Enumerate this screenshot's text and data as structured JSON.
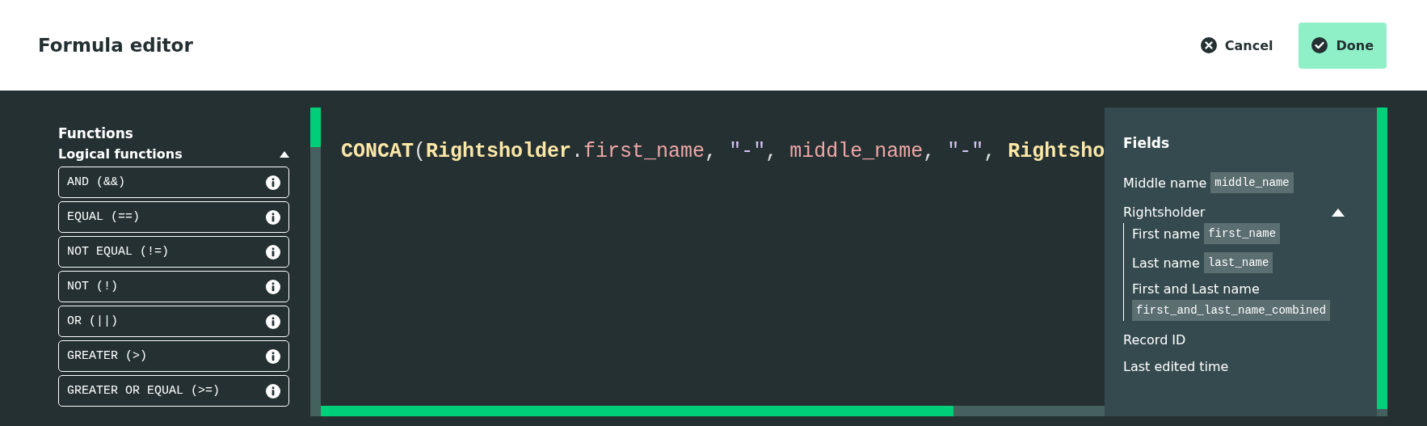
{
  "header": {
    "title": "Formula editor",
    "buttons": [
      {
        "kind": "cancel",
        "label": "Cancel"
      },
      {
        "kind": "done",
        "label": "Done"
      }
    ]
  },
  "functions": {
    "title": "Functions",
    "groups": [
      {
        "label": "Logical functions",
        "expanded": true,
        "items": [
          "AND (&&)",
          "EQUAL (==)",
          "NOT EQUAL (!=)",
          "NOT (!)",
          "OR (||)",
          "GREATER (>)",
          "GREATER OR EQUAL (>=)"
        ]
      }
    ]
  },
  "editor": {
    "tokens": [
      {
        "kind": "function",
        "text": "CONCAT"
      },
      {
        "kind": "punct",
        "text": "("
      },
      {
        "kind": "object",
        "text": "Rightsholder"
      },
      {
        "kind": "punct",
        "text": "."
      },
      {
        "kind": "field",
        "text": "first_name"
      },
      {
        "kind": "punct",
        "text": ", "
      },
      {
        "kind": "string",
        "text": "\"-\""
      },
      {
        "kind": "punct",
        "text": ", "
      },
      {
        "kind": "field",
        "text": "middle_name"
      },
      {
        "kind": "punct",
        "text": ", "
      },
      {
        "kind": "string",
        "text": "\"-\""
      },
      {
        "kind": "punct",
        "text": ", "
      },
      {
        "kind": "object",
        "text": "Rightsho"
      }
    ]
  },
  "fields": {
    "title": "Fields",
    "items": [
      {
        "label": "Middle name",
        "code": "middle_name"
      },
      {
        "label": "Rightsholder",
        "expanded": true,
        "children": [
          {
            "label": "First name",
            "code": "first_name"
          },
          {
            "label": "Last name",
            "code": "last_name"
          },
          {
            "label": "First and Last name",
            "code": "first_and_last_name_combined"
          }
        ]
      },
      {
        "label": "Record ID"
      },
      {
        "label": "Last edited time"
      }
    ]
  }
}
